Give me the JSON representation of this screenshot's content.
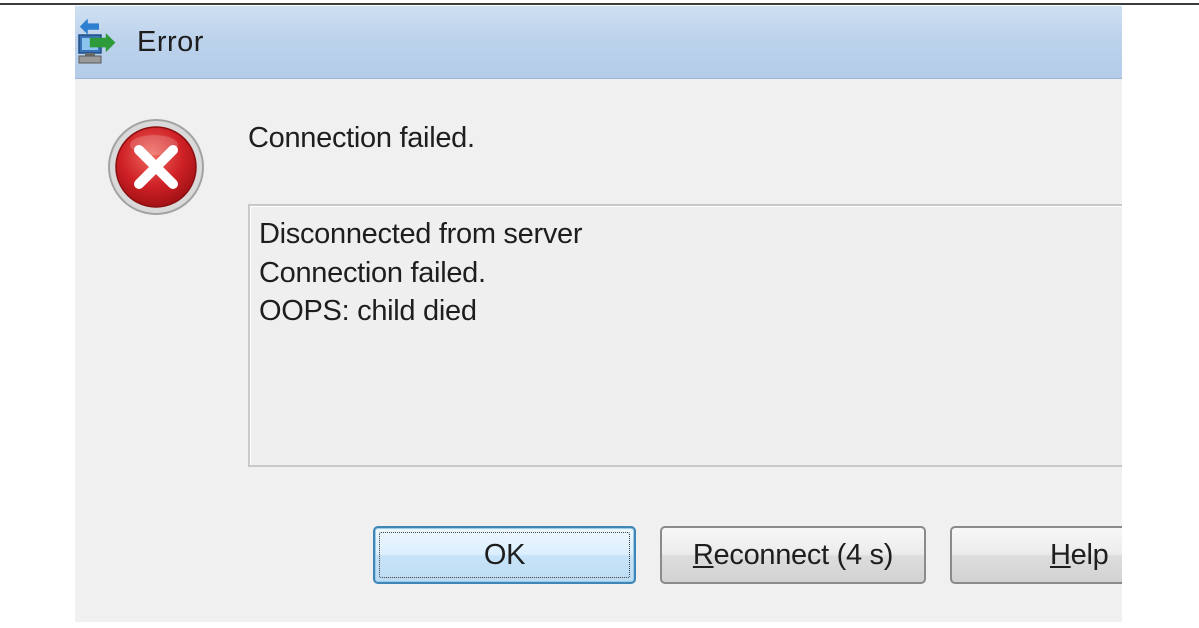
{
  "dialog": {
    "title": "Error",
    "icon_name": "network-error-icon",
    "message": "Connection failed.",
    "status_icon": "error-x-icon",
    "details": [
      "Disconnected from server",
      "Connection failed.",
      "OOPS: child died"
    ],
    "buttons": {
      "ok_label": "OK",
      "reconnect_mnemonic": "R",
      "reconnect_rest": "econnect (4 s)",
      "help_mnemonic": "H",
      "help_rest": "elp"
    }
  },
  "colors": {
    "titlebar": "#bdd3ec",
    "dialog_bg": "#f0f0f0",
    "error_red": "#c8191e",
    "focus_border": "#3e86b7"
  }
}
